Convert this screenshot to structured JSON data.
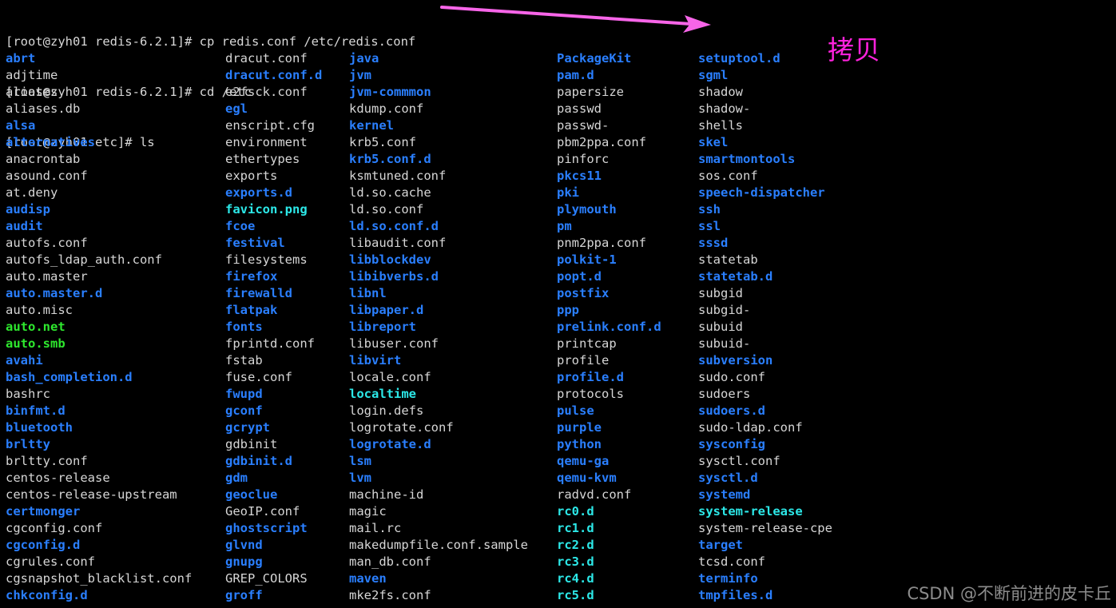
{
  "terminal": {
    "prompt_lines": [
      "[root@zyh01 redis-6.2.1]# cp redis.conf /etc/redis.conf",
      "[root@zyh01 redis-6.2.1]# cd /etc",
      "[root@zyh01 etc]# ls"
    ],
    "colors": {
      "background": "#000000",
      "foreground": "#d8d8d8",
      "directory": "#2a7fff",
      "symlink": "#2ce8e8",
      "executable": "#2ee82e",
      "image": "#2ce8e8",
      "annotation": "#ff22dd",
      "watermark": "#8c8c8c"
    },
    "columns": [
      {
        "entries": [
          {
            "name": "abrt",
            "type": "dir"
          },
          {
            "name": "adjtime",
            "type": "file"
          },
          {
            "name": "aliases",
            "type": "file"
          },
          {
            "name": "aliases.db",
            "type": "file"
          },
          {
            "name": "alsa",
            "type": "dir"
          },
          {
            "name": "alternatives",
            "type": "dir"
          },
          {
            "name": "anacrontab",
            "type": "file"
          },
          {
            "name": "asound.conf",
            "type": "file"
          },
          {
            "name": "at.deny",
            "type": "file"
          },
          {
            "name": "audisp",
            "type": "dir"
          },
          {
            "name": "audit",
            "type": "dir"
          },
          {
            "name": "autofs.conf",
            "type": "file"
          },
          {
            "name": "autofs_ldap_auth.conf",
            "type": "file"
          },
          {
            "name": "auto.master",
            "type": "file"
          },
          {
            "name": "auto.master.d",
            "type": "dir"
          },
          {
            "name": "auto.misc",
            "type": "file"
          },
          {
            "name": "auto.net",
            "type": "exec"
          },
          {
            "name": "auto.smb",
            "type": "exec"
          },
          {
            "name": "avahi",
            "type": "dir"
          },
          {
            "name": "bash_completion.d",
            "type": "dir"
          },
          {
            "name": "bashrc",
            "type": "file"
          },
          {
            "name": "binfmt.d",
            "type": "dir"
          },
          {
            "name": "bluetooth",
            "type": "dir"
          },
          {
            "name": "brltty",
            "type": "dir"
          },
          {
            "name": "brltty.conf",
            "type": "file"
          },
          {
            "name": "centos-release",
            "type": "file"
          },
          {
            "name": "centos-release-upstream",
            "type": "file"
          },
          {
            "name": "certmonger",
            "type": "dir"
          },
          {
            "name": "cgconfig.conf",
            "type": "file"
          },
          {
            "name": "cgconfig.d",
            "type": "dir"
          },
          {
            "name": "cgrules.conf",
            "type": "file"
          },
          {
            "name": "cgsnapshot_blacklist.conf",
            "type": "file"
          },
          {
            "name": "chkconfig.d",
            "type": "dir"
          }
        ]
      },
      {
        "entries": [
          {
            "name": "dracut.conf",
            "type": "file"
          },
          {
            "name": "dracut.conf.d",
            "type": "dir"
          },
          {
            "name": "e2fsck.conf",
            "type": "file"
          },
          {
            "name": "egl",
            "type": "dir"
          },
          {
            "name": "enscript.cfg",
            "type": "file"
          },
          {
            "name": "environment",
            "type": "file"
          },
          {
            "name": "ethertypes",
            "type": "file"
          },
          {
            "name": "exports",
            "type": "file"
          },
          {
            "name": "exports.d",
            "type": "dir"
          },
          {
            "name": "favicon.png",
            "type": "img"
          },
          {
            "name": "fcoe",
            "type": "dir"
          },
          {
            "name": "festival",
            "type": "dir"
          },
          {
            "name": "filesystems",
            "type": "file"
          },
          {
            "name": "firefox",
            "type": "dir"
          },
          {
            "name": "firewalld",
            "type": "dir"
          },
          {
            "name": "flatpak",
            "type": "dir"
          },
          {
            "name": "fonts",
            "type": "dir"
          },
          {
            "name": "fprintd.conf",
            "type": "file"
          },
          {
            "name": "fstab",
            "type": "file"
          },
          {
            "name": "fuse.conf",
            "type": "file"
          },
          {
            "name": "fwupd",
            "type": "dir"
          },
          {
            "name": "gconf",
            "type": "dir"
          },
          {
            "name": "gcrypt",
            "type": "dir"
          },
          {
            "name": "gdbinit",
            "type": "file"
          },
          {
            "name": "gdbinit.d",
            "type": "dir"
          },
          {
            "name": "gdm",
            "type": "dir"
          },
          {
            "name": "geoclue",
            "type": "dir"
          },
          {
            "name": "GeoIP.conf",
            "type": "file"
          },
          {
            "name": "ghostscript",
            "type": "dir"
          },
          {
            "name": "glvnd",
            "type": "dir"
          },
          {
            "name": "gnupg",
            "type": "dir"
          },
          {
            "name": "GREP_COLORS",
            "type": "file"
          },
          {
            "name": "groff",
            "type": "dir"
          }
        ]
      },
      {
        "entries": [
          {
            "name": "java",
            "type": "dir"
          },
          {
            "name": "jvm",
            "type": "dir"
          },
          {
            "name": "jvm-commmon",
            "type": "dir"
          },
          {
            "name": "kdump.conf",
            "type": "file"
          },
          {
            "name": "kernel",
            "type": "dir"
          },
          {
            "name": "krb5.conf",
            "type": "file"
          },
          {
            "name": "krb5.conf.d",
            "type": "dir"
          },
          {
            "name": "ksmtuned.conf",
            "type": "file"
          },
          {
            "name": "ld.so.cache",
            "type": "file"
          },
          {
            "name": "ld.so.conf",
            "type": "file"
          },
          {
            "name": "ld.so.conf.d",
            "type": "dir"
          },
          {
            "name": "libaudit.conf",
            "type": "file"
          },
          {
            "name": "libblockdev",
            "type": "dir"
          },
          {
            "name": "libibverbs.d",
            "type": "dir"
          },
          {
            "name": "libnl",
            "type": "dir"
          },
          {
            "name": "libpaper.d",
            "type": "dir"
          },
          {
            "name": "libreport",
            "type": "dir"
          },
          {
            "name": "libuser.conf",
            "type": "file"
          },
          {
            "name": "libvirt",
            "type": "dir"
          },
          {
            "name": "locale.conf",
            "type": "file"
          },
          {
            "name": "localtime",
            "type": "link"
          },
          {
            "name": "login.defs",
            "type": "file"
          },
          {
            "name": "logrotate.conf",
            "type": "file"
          },
          {
            "name": "logrotate.d",
            "type": "dir"
          },
          {
            "name": "lsm",
            "type": "dir"
          },
          {
            "name": "lvm",
            "type": "dir"
          },
          {
            "name": "machine-id",
            "type": "file"
          },
          {
            "name": "magic",
            "type": "file"
          },
          {
            "name": "mail.rc",
            "type": "file"
          },
          {
            "name": "makedumpfile.conf.sample",
            "type": "file"
          },
          {
            "name": "man_db.conf",
            "type": "file"
          },
          {
            "name": "maven",
            "type": "dir"
          },
          {
            "name": "mke2fs.conf",
            "type": "file"
          }
        ]
      },
      {
        "entries": [
          {
            "name": "PackageKit",
            "type": "dir"
          },
          {
            "name": "pam.d",
            "type": "dir"
          },
          {
            "name": "papersize",
            "type": "file"
          },
          {
            "name": "passwd",
            "type": "file"
          },
          {
            "name": "passwd-",
            "type": "file"
          },
          {
            "name": "pbm2ppa.conf",
            "type": "file"
          },
          {
            "name": "pinforc",
            "type": "file"
          },
          {
            "name": "pkcs11",
            "type": "dir"
          },
          {
            "name": "pki",
            "type": "dir"
          },
          {
            "name": "plymouth",
            "type": "dir"
          },
          {
            "name": "pm",
            "type": "dir"
          },
          {
            "name": "pnm2ppa.conf",
            "type": "file"
          },
          {
            "name": "polkit-1",
            "type": "dir"
          },
          {
            "name": "popt.d",
            "type": "dir"
          },
          {
            "name": "postfix",
            "type": "dir"
          },
          {
            "name": "ppp",
            "type": "dir"
          },
          {
            "name": "prelink.conf.d",
            "type": "dir"
          },
          {
            "name": "printcap",
            "type": "file"
          },
          {
            "name": "profile",
            "type": "file"
          },
          {
            "name": "profile.d",
            "type": "dir"
          },
          {
            "name": "protocols",
            "type": "file"
          },
          {
            "name": "pulse",
            "type": "dir"
          },
          {
            "name": "purple",
            "type": "dir"
          },
          {
            "name": "python",
            "type": "dir"
          },
          {
            "name": "qemu-ga",
            "type": "dir"
          },
          {
            "name": "qemu-kvm",
            "type": "dir"
          },
          {
            "name": "radvd.conf",
            "type": "file"
          },
          {
            "name": "rc0.d",
            "type": "link"
          },
          {
            "name": "rc1.d",
            "type": "link"
          },
          {
            "name": "rc2.d",
            "type": "link"
          },
          {
            "name": "rc3.d",
            "type": "link"
          },
          {
            "name": "rc4.d",
            "type": "link"
          },
          {
            "name": "rc5.d",
            "type": "link"
          }
        ]
      },
      {
        "entries": [
          {
            "name": "setuptool.d",
            "type": "dir"
          },
          {
            "name": "sgml",
            "type": "dir"
          },
          {
            "name": "shadow",
            "type": "file"
          },
          {
            "name": "shadow-",
            "type": "file"
          },
          {
            "name": "shells",
            "type": "file"
          },
          {
            "name": "skel",
            "type": "dir"
          },
          {
            "name": "smartmontools",
            "type": "dir"
          },
          {
            "name": "sos.conf",
            "type": "file"
          },
          {
            "name": "speech-dispatcher",
            "type": "dir"
          },
          {
            "name": "ssh",
            "type": "dir"
          },
          {
            "name": "ssl",
            "type": "dir"
          },
          {
            "name": "sssd",
            "type": "dir"
          },
          {
            "name": "statetab",
            "type": "file"
          },
          {
            "name": "statetab.d",
            "type": "dir"
          },
          {
            "name": "subgid",
            "type": "file"
          },
          {
            "name": "subgid-",
            "type": "file"
          },
          {
            "name": "subuid",
            "type": "file"
          },
          {
            "name": "subuid-",
            "type": "file"
          },
          {
            "name": "subversion",
            "type": "dir"
          },
          {
            "name": "sudo.conf",
            "type": "file"
          },
          {
            "name": "sudoers",
            "type": "file"
          },
          {
            "name": "sudoers.d",
            "type": "dir"
          },
          {
            "name": "sudo-ldap.conf",
            "type": "file"
          },
          {
            "name": "sysconfig",
            "type": "dir"
          },
          {
            "name": "sysctl.conf",
            "type": "file"
          },
          {
            "name": "sysctl.d",
            "type": "dir"
          },
          {
            "name": "systemd",
            "type": "dir"
          },
          {
            "name": "system-release",
            "type": "link"
          },
          {
            "name": "system-release-cpe",
            "type": "file"
          },
          {
            "name": "target",
            "type": "dir"
          },
          {
            "name": "tcsd.conf",
            "type": "file"
          },
          {
            "name": "terminfo",
            "type": "dir"
          },
          {
            "name": "tmpfiles.d",
            "type": "dir"
          }
        ]
      }
    ]
  },
  "annotations": {
    "copy_label": "拷贝",
    "watermark": "CSDN @不断前进的皮卡丘"
  }
}
